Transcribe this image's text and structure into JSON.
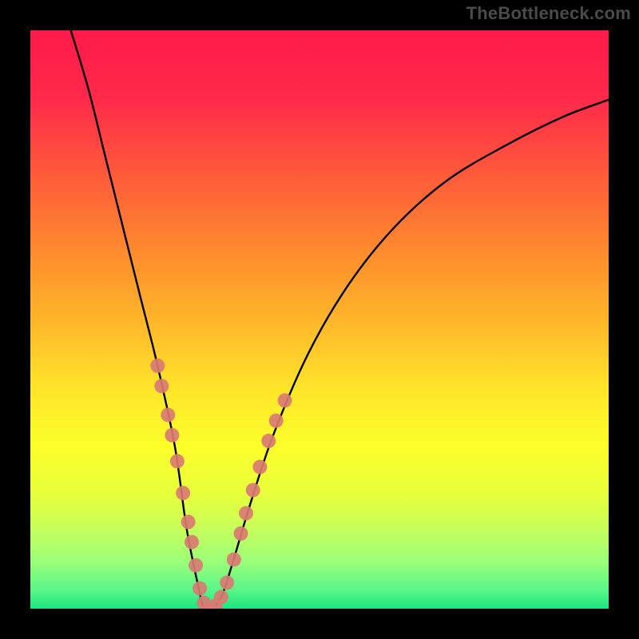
{
  "watermark": "TheBottleneck.com",
  "chart_data": {
    "type": "line",
    "title": "",
    "xlabel": "",
    "ylabel": "",
    "xlim": [
      0,
      100
    ],
    "ylim": [
      0,
      100
    ],
    "series": [
      {
        "name": "bottleneck-curve",
        "x": [
          7,
          10,
          13,
          16,
          19,
          22,
          25,
          27,
          29,
          30,
          31,
          33,
          35,
          38,
          42,
          48,
          55,
          63,
          72,
          82,
          92,
          100
        ],
        "values": [
          100,
          90,
          78,
          66,
          54,
          42,
          28,
          14,
          4,
          0,
          0,
          2,
          8,
          18,
          30,
          44,
          56,
          66,
          74,
          80,
          85,
          88
        ]
      }
    ],
    "markers": {
      "name": "data-points",
      "color": "#d97b72",
      "points": [
        {
          "x": 22.0,
          "y": 42.0
        },
        {
          "x": 22.7,
          "y": 38.5
        },
        {
          "x": 23.8,
          "y": 33.5
        },
        {
          "x": 24.5,
          "y": 30.0
        },
        {
          "x": 25.4,
          "y": 25.5
        },
        {
          "x": 26.4,
          "y": 20.0
        },
        {
          "x": 27.3,
          "y": 15.0
        },
        {
          "x": 27.9,
          "y": 11.5
        },
        {
          "x": 28.6,
          "y": 7.5
        },
        {
          "x": 29.3,
          "y": 3.5
        },
        {
          "x": 30.0,
          "y": 1.0
        },
        {
          "x": 31.0,
          "y": 0.0
        },
        {
          "x": 32.0,
          "y": 0.5
        },
        {
          "x": 33.0,
          "y": 2.0
        },
        {
          "x": 34.0,
          "y": 4.5
        },
        {
          "x": 35.2,
          "y": 8.5
        },
        {
          "x": 36.4,
          "y": 13.0
        },
        {
          "x": 37.3,
          "y": 16.5
        },
        {
          "x": 38.5,
          "y": 20.5
        },
        {
          "x": 39.7,
          "y": 24.5
        },
        {
          "x": 41.2,
          "y": 29.0
        },
        {
          "x": 42.5,
          "y": 32.5
        },
        {
          "x": 44.0,
          "y": 36.0
        }
      ]
    },
    "gradient_stops": [
      {
        "pos": 0,
        "color": "#ff1a4a"
      },
      {
        "pos": 12,
        "color": "#ff2a4a"
      },
      {
        "pos": 25,
        "color": "#ff5a3a"
      },
      {
        "pos": 38,
        "color": "#ff8a2e"
      },
      {
        "pos": 50,
        "color": "#ffb52a"
      },
      {
        "pos": 62,
        "color": "#ffe52a"
      },
      {
        "pos": 72,
        "color": "#fcff2a"
      },
      {
        "pos": 80,
        "color": "#e8ff3a"
      },
      {
        "pos": 86,
        "color": "#c8ff5a"
      },
      {
        "pos": 92,
        "color": "#9aff7a"
      },
      {
        "pos": 97,
        "color": "#56f588"
      },
      {
        "pos": 100,
        "color": "#1ce67e"
      }
    ]
  }
}
